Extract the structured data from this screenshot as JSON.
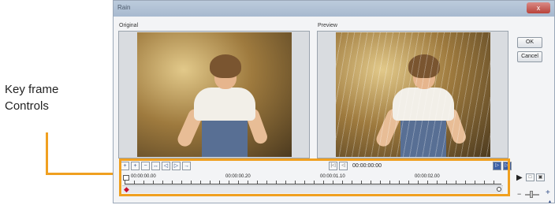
{
  "annotation": {
    "line1": "Key frame",
    "line2": "Controls"
  },
  "window": {
    "title": "Rain",
    "close_label": "x"
  },
  "panes": {
    "original_label": "Original",
    "preview_label": "Preview"
  },
  "buttons": {
    "ok": "OK",
    "cancel": "Cancel"
  },
  "toolbar": {
    "tool_icons": [
      "+",
      "+",
      "−",
      "↔",
      "◁",
      "▷",
      "→"
    ],
    "nav_prev_icon": "|◁",
    "nav_back_icon": "◁",
    "nav_fwd_icon": "▷",
    "nav_next_icon": "▷|",
    "timecode": "00:00:00:00"
  },
  "timeline": {
    "ruler_labels": [
      "00:00:00.00",
      "00:00:00.20",
      "00:00:01.10",
      "00:00:02.00"
    ]
  },
  "playback": {
    "play_icon": "▶",
    "btn1_icon": "□",
    "btn2_icon": "▣"
  },
  "zoom": {
    "minus_icon": "−",
    "plus_icon": "+"
  },
  "colors": {
    "annotation_accent": "#f0a020",
    "keyframe_marker": "#c8102e",
    "titlebar": "#a7b9cf"
  }
}
